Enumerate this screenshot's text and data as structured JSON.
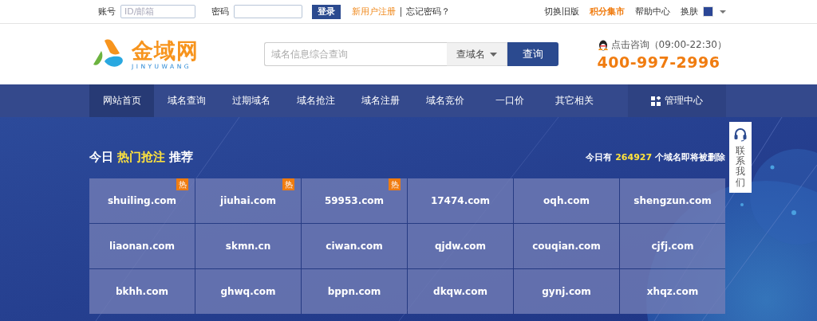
{
  "top_bar": {
    "account_label": "账号",
    "account_field": {
      "placeholder": "ID/邮箱"
    },
    "password_label": "密码",
    "login_button": "登录",
    "register_link": "新用户注册",
    "forgot_link": "忘记密码？",
    "right_links": [
      {
        "label": "切换旧版",
        "highlighted": false
      },
      {
        "label": "积分集市",
        "highlighted": true
      },
      {
        "label": "帮助中心",
        "highlighted": false
      }
    ],
    "skin_label": "换肤"
  },
  "header": {
    "logo": {
      "name": "金域网",
      "subtitle": "JINYUWANG"
    },
    "search": {
      "placeholder": "域名信息综合查询",
      "type": "查域名",
      "button": "查询"
    },
    "contact": {
      "label": "点击咨询（09:00-22:30）",
      "phone": "400-997-2996"
    }
  },
  "nav": [
    {
      "label": "网站首页",
      "selected": true,
      "kind": "link"
    },
    {
      "label": "域名查询",
      "selected": false,
      "kind": "link"
    },
    {
      "label": "过期域名",
      "selected": false,
      "kind": "link"
    },
    {
      "label": "域名抢注",
      "selected": false,
      "kind": "link"
    },
    {
      "label": "域名注册",
      "selected": false,
      "kind": "link"
    },
    {
      "label": "域名竞价",
      "selected": false,
      "kind": "link"
    },
    {
      "label": "一口价",
      "selected": false,
      "kind": "link"
    },
    {
      "label": "其它相关",
      "selected": false,
      "kind": "link"
    },
    {
      "label": "管理中心",
      "selected": false,
      "kind": "admin"
    }
  ],
  "banner": {
    "title": "今日 **热门抢注** 推荐",
    "count_text": "今日有 **264927** 个域名即将被删除",
    "domains": [
      {
        "name": "shuiling.com",
        "hot": true,
        "badge": "热"
      },
      {
        "name": "jiuhai.com",
        "hot": true,
        "badge": "热"
      },
      {
        "name": "59953.com",
        "hot": true,
        "badge": "热"
      },
      {
        "name": "17474.com",
        "hot": false
      },
      {
        "name": "oqh.com",
        "hot": false
      },
      {
        "name": "shengzun.com",
        "hot": false
      },
      {
        "name": "liaonan.com",
        "hot": false
      },
      {
        "name": "skmn.cn",
        "hot": false
      },
      {
        "name": "ciwan.com",
        "hot": false
      },
      {
        "name": "qjdw.com",
        "hot": false
      },
      {
        "name": "couqian.com",
        "hot": false
      },
      {
        "name": "cjfj.com",
        "hot": false
      },
      {
        "name": "bkhh.com",
        "hot": false
      },
      {
        "name": "ghwq.com",
        "hot": false
      },
      {
        "name": "bppn.com",
        "hot": false
      },
      {
        "name": "dkqw.com",
        "hot": false
      },
      {
        "name": "gynj.com",
        "hot": false
      },
      {
        "name": "xhqz.com",
        "hot": false
      }
    ]
  },
  "side_contact": {
    "label": "联系我们"
  }
}
